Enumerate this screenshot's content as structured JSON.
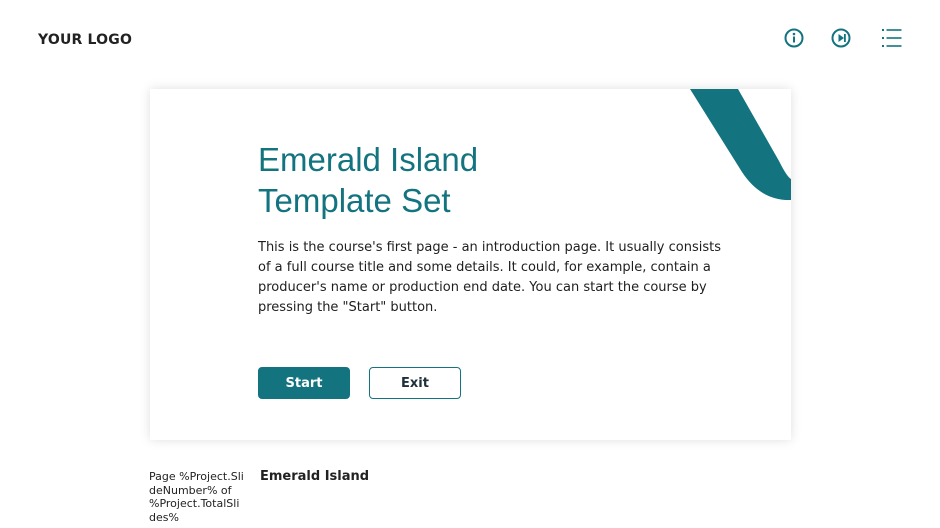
{
  "header": {
    "logo_text": "YOUR LOGO",
    "icons": [
      "info-icon",
      "player-controls-icon",
      "menu-list-icon"
    ]
  },
  "slide": {
    "title_line1": "Emerald Island",
    "title_line2": "Template Set",
    "description": "This is the course's first page - an introduction page. It usually consists of a full course title and some details. It could, for example, contain a producer's name or production end date. You can start the course by pressing the \"Start\" button.",
    "start_label": "Start",
    "exit_label": "Exit"
  },
  "footer": {
    "page_text": "Page %Project.SlideNumber% of %Project.TotalSlides%",
    "course_title": "Emerald Island"
  },
  "colors": {
    "accent": "#137480",
    "text": "#1e1e1e",
    "background": "#ffffff"
  }
}
